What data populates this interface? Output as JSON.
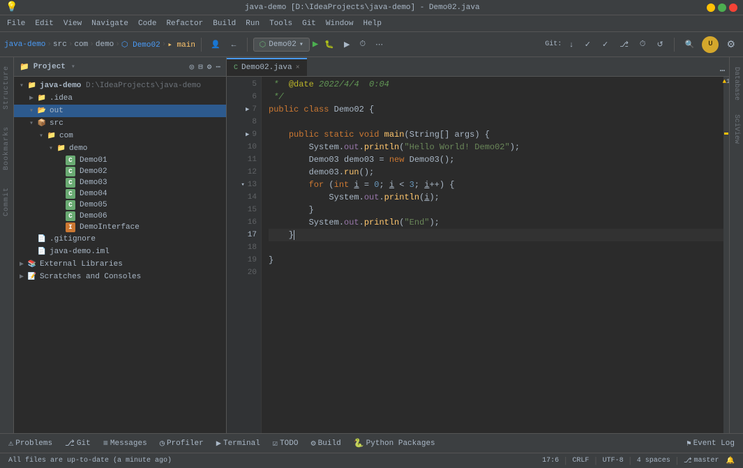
{
  "titleBar": {
    "title": "java-demo [D:\\IdeaProjects\\java-demo] - Demo02.java",
    "minBtn": "−",
    "maxBtn": "□",
    "closeBtn": "×"
  },
  "menuBar": {
    "items": [
      "File",
      "Edit",
      "View",
      "Navigate",
      "Code",
      "Refactor",
      "Build",
      "Run",
      "Tools",
      "Git",
      "Window",
      "Help"
    ]
  },
  "toolbar": {
    "breadcrumbs": [
      "java-demo",
      "src",
      "com",
      "demo",
      "Demo02",
      "main"
    ],
    "runConfig": "Demo02",
    "gitLabel": "Git:"
  },
  "projectPanel": {
    "title": "Project",
    "root": "java-demo",
    "rootPath": "D:\\IdeaProjects\\java-demo",
    "items": [
      {
        "label": ".idea",
        "type": "folder",
        "depth": 1,
        "collapsed": true
      },
      {
        "label": "out",
        "type": "folder-open",
        "depth": 1,
        "selected": true
      },
      {
        "label": "src",
        "type": "src-folder",
        "depth": 1,
        "collapsed": false
      },
      {
        "label": "com",
        "type": "folder",
        "depth": 2,
        "collapsed": false
      },
      {
        "label": "demo",
        "type": "folder",
        "depth": 3,
        "collapsed": false
      },
      {
        "label": "Demo01",
        "type": "class-c",
        "depth": 4
      },
      {
        "label": "Demo02",
        "type": "class-c",
        "depth": 4
      },
      {
        "label": "Demo03",
        "type": "class-c",
        "depth": 4
      },
      {
        "label": "Demo04",
        "type": "class-c",
        "depth": 4
      },
      {
        "label": "Demo05",
        "type": "class-c",
        "depth": 4
      },
      {
        "label": "Demo06",
        "type": "class-c",
        "depth": 4
      },
      {
        "label": "DemoInterface",
        "type": "class-i",
        "depth": 4
      },
      {
        "label": ".gitignore",
        "type": "file",
        "depth": 1
      },
      {
        "label": "java-demo.iml",
        "type": "file",
        "depth": 1
      },
      {
        "label": "External Libraries",
        "type": "folder-ext",
        "depth": 0,
        "collapsed": true
      },
      {
        "label": "Scratches and Consoles",
        "type": "folder-scratch",
        "depth": 0,
        "collapsed": true
      }
    ]
  },
  "editor": {
    "tabLabel": "Demo02.java",
    "lines": [
      {
        "num": 5,
        "content": " *  @date 2022/4/4 0:04",
        "hasArrow": false
      },
      {
        "num": 6,
        "content": " */",
        "hasArrow": false
      },
      {
        "num": 7,
        "content": "public class Demo02 {",
        "hasArrow": true
      },
      {
        "num": 8,
        "content": "",
        "hasArrow": false
      },
      {
        "num": 9,
        "content": "    public static void main(String[] args) {",
        "hasArrow": true
      },
      {
        "num": 10,
        "content": "        System.out.println(\"Hello World! Demo02\");",
        "hasArrow": false
      },
      {
        "num": 11,
        "content": "        Demo03 demo03 = new Demo03();",
        "hasArrow": false
      },
      {
        "num": 12,
        "content": "        demo03.run();",
        "hasArrow": false
      },
      {
        "num": 13,
        "content": "        for (int i = 0; i < 3; i++) {",
        "hasArrow": true
      },
      {
        "num": 14,
        "content": "            System.out.println(i);",
        "hasArrow": false
      },
      {
        "num": 15,
        "content": "        }",
        "hasArrow": false
      },
      {
        "num": 16,
        "content": "        System.out.println(\"End\");",
        "hasArrow": false
      },
      {
        "num": 17,
        "content": "    }",
        "hasArrow": false,
        "current": true
      },
      {
        "num": 18,
        "content": "",
        "hasArrow": false
      },
      {
        "num": 19,
        "content": "}",
        "hasArrow": false
      },
      {
        "num": 20,
        "content": "",
        "hasArrow": false
      }
    ]
  },
  "rightPanels": {
    "database": "Database",
    "sciview": "SciView"
  },
  "leftPanels": {
    "structure": "Structure",
    "bookmarks": "Bookmarks",
    "commit": "Commit"
  },
  "warningCount": "▲ 1",
  "bottomTabs": [
    {
      "icon": "⚠",
      "label": "Problems"
    },
    {
      "icon": "⎇",
      "label": "Git"
    },
    {
      "icon": "≡",
      "label": "Messages"
    },
    {
      "icon": "◷",
      "label": "Profiler"
    },
    {
      "icon": "▶",
      "label": "Terminal"
    },
    {
      "icon": "☑",
      "label": "TODO"
    },
    {
      "icon": "⚙",
      "label": "Build"
    },
    {
      "icon": "🐍",
      "label": "Python Packages"
    }
  ],
  "statusBar": {
    "message": "All files are up-to-date (a minute ago)",
    "cursorPos": "17:6",
    "lineEnding": "CRLF",
    "encoding": "UTF-8",
    "indent": "4 spaces",
    "branch": "master",
    "eventLog": "Event Log"
  }
}
